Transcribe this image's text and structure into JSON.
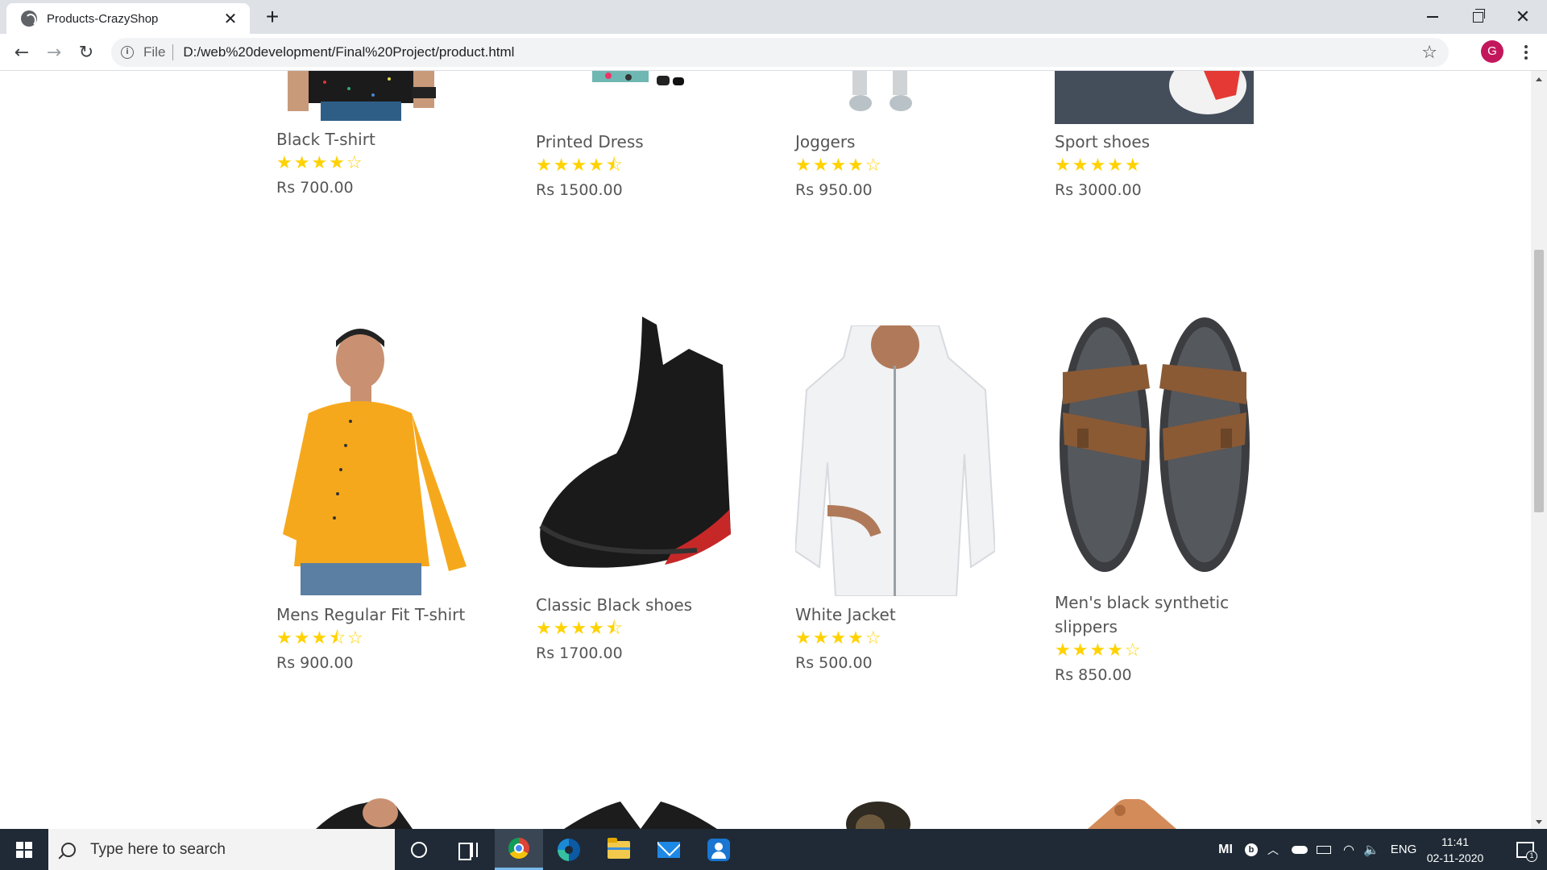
{
  "browser": {
    "tab_title": "Products-CrazyShop",
    "tab_close": "✕",
    "new_tab": "+",
    "scheme_label": "File",
    "url": "D:/web%20development/Final%20Project/product.html",
    "profile_initial": "G"
  },
  "products_row1": [
    {
      "name": "Black T-shirt",
      "rating": "★★★★☆",
      "rating_value": 4,
      "price": "Rs 700.00"
    },
    {
      "name": "Printed Dress",
      "rating": "★★★★⯪",
      "rating_value": 4.5,
      "price": "Rs 1500.00"
    },
    {
      "name": "Joggers",
      "rating": "★★★★☆",
      "rating_value": 4,
      "price": "Rs 950.00"
    },
    {
      "name": "Sport shoes",
      "rating": "★★★★★",
      "rating_value": 5,
      "price": "Rs 3000.00"
    }
  ],
  "products_row2": [
    {
      "name": "Mens Regular Fit T-shirt",
      "rating": "★★★⯪☆",
      "rating_value": 3.5,
      "price": "Rs 900.00"
    },
    {
      "name": "Classic Black shoes",
      "rating": "★★★★⯪",
      "rating_value": 4.5,
      "price": "Rs 1700.00"
    },
    {
      "name": "White Jacket",
      "rating": "★★★★☆",
      "rating_value": 4,
      "price": "Rs 500.00"
    },
    {
      "name": "Men's black synthetic slippers",
      "rating": "★★★★☆",
      "rating_value": 4,
      "price": "Rs 850.00"
    }
  ],
  "colors": {
    "star": "#ffd200",
    "text": "#555555",
    "taskbar": "#1f2a36"
  },
  "taskbar": {
    "search_placeholder": "Type here to search",
    "tray_lang": "ENG",
    "tray_time": "11:41",
    "tray_date": "02-11-2020",
    "notification_count": "1",
    "tray_mi": "MI"
  }
}
